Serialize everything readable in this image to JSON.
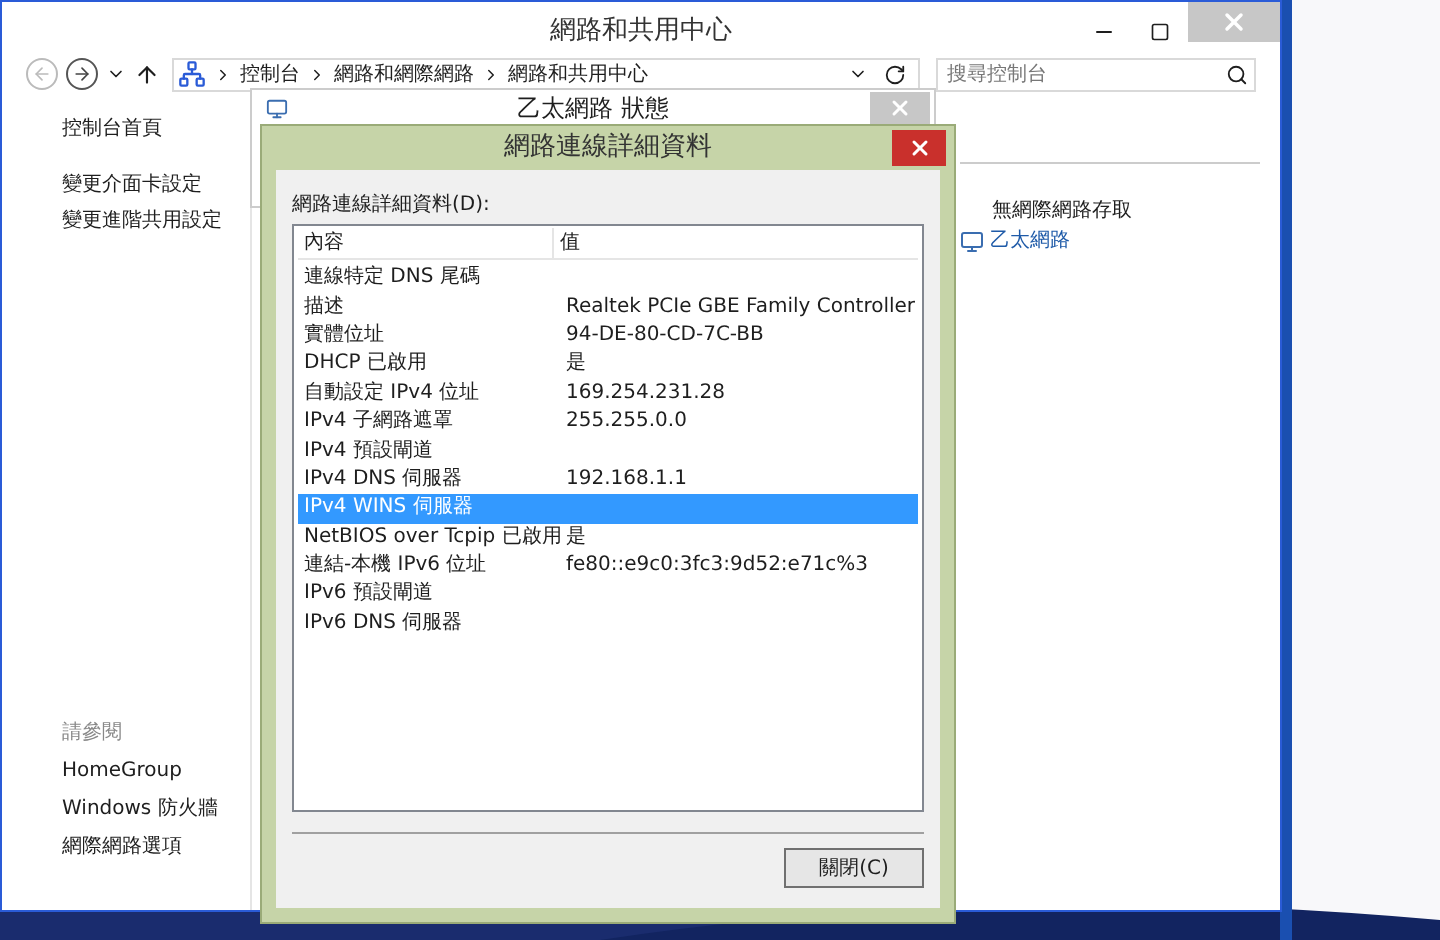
{
  "window": {
    "title": "網路和共用中心"
  },
  "breadcrumbs": [
    "控制台",
    "網路和網際網路",
    "網路和共用中心"
  ],
  "search": {
    "placeholder": "搜尋控制台"
  },
  "sidebar": {
    "items": [
      "控制台首頁",
      "變更介面卡設定",
      "變更進階共用設定"
    ],
    "see_also": {
      "title": "請參閱",
      "items": [
        "HomeGroup",
        "Windows 防火牆",
        "網際網路選項"
      ]
    }
  },
  "network": {
    "access": "無網際網路存取",
    "connection": "乙太網路"
  },
  "status_dialog": {
    "title": "乙太網路 狀態"
  },
  "details_dialog": {
    "title": "網路連線詳細資料",
    "label": "網路連線詳細資料(D):",
    "columns": [
      "內容",
      "值"
    ],
    "rows": [
      {
        "property": "連線特定 DNS 尾碼",
        "value": "",
        "selected": false
      },
      {
        "property": "描述",
        "value": "Realtek PCIe GBE Family Controller",
        "selected": false
      },
      {
        "property": "實體位址",
        "value": "94-DE-80-CD-7C-BB",
        "selected": false
      },
      {
        "property": "DHCP 已啟用",
        "value": "是",
        "selected": false
      },
      {
        "property": "自動設定 IPv4 位址",
        "value": "169.254.231.28",
        "selected": false
      },
      {
        "property": "IPv4 子網路遮罩",
        "value": "255.255.0.0",
        "selected": false
      },
      {
        "property": "IPv4 預設閘道",
        "value": "",
        "selected": false
      },
      {
        "property": "IPv4 DNS 伺服器",
        "value": "192.168.1.1",
        "selected": false
      },
      {
        "property": "IPv4 WINS 伺服器",
        "value": "",
        "selected": true
      },
      {
        "property": "NetBIOS over Tcpip 已啟用",
        "value": "是",
        "selected": false
      },
      {
        "property": "連結-本機 IPv6 位址",
        "value": "fe80::e9c0:3fc3:9d52:e71c%3",
        "selected": false
      },
      {
        "property": "IPv6 預設閘道",
        "value": "",
        "selected": false
      },
      {
        "property": "IPv6 DNS 伺服器",
        "value": "",
        "selected": false
      }
    ],
    "close_button": "關閉(C)"
  }
}
